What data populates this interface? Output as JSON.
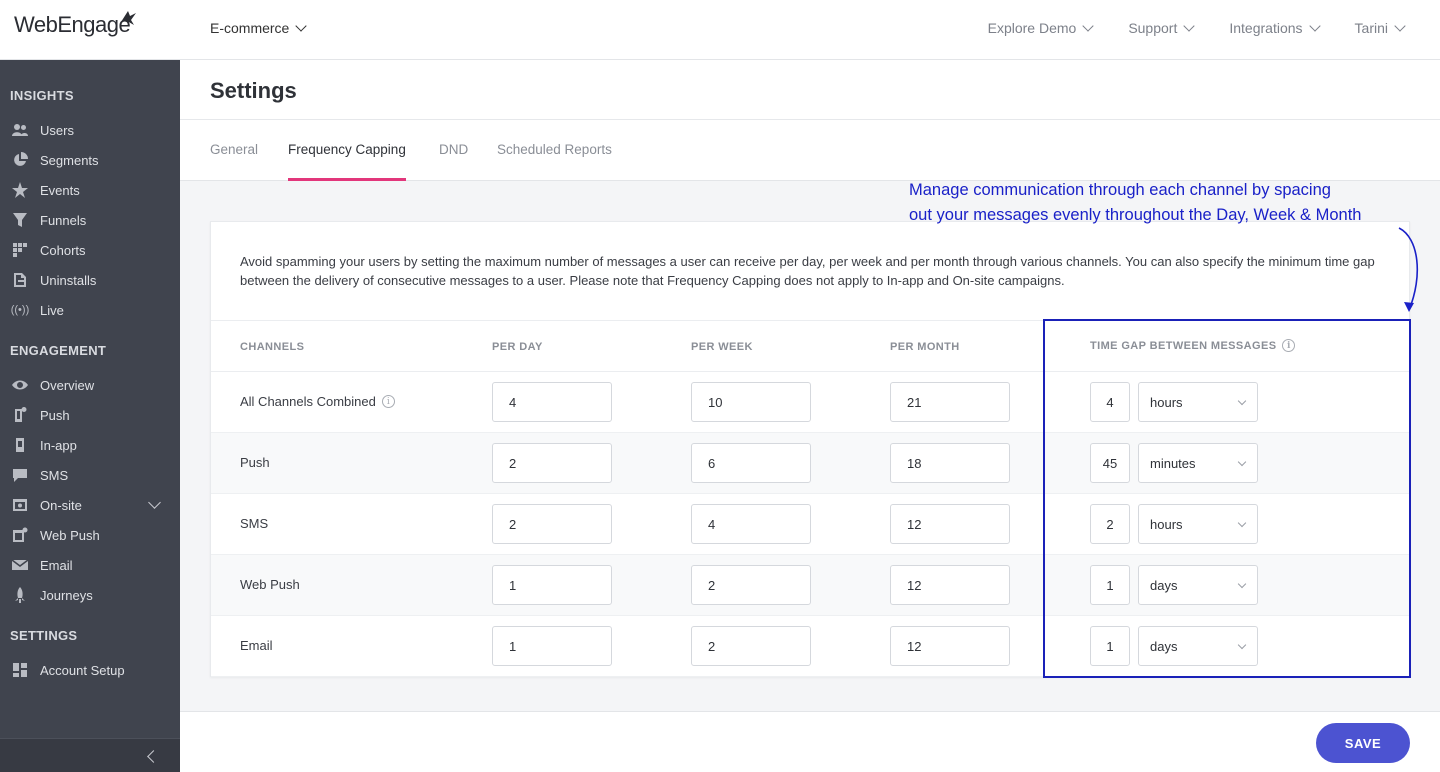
{
  "brand": {
    "logo_text": "WebEngage",
    "accent": "#e2367b",
    "primary": "#4c53d1",
    "annotation_color": "#1a21c8"
  },
  "header": {
    "project": "E-commerce",
    "nav": [
      "Explore Demo",
      "Support",
      "Integrations",
      "Tarini"
    ]
  },
  "sidebar": {
    "sections": [
      {
        "title": "INSIGHTS",
        "items": [
          {
            "label": "Users",
            "icon": "users-icon"
          },
          {
            "label": "Segments",
            "icon": "pie-chart-icon"
          },
          {
            "label": "Events",
            "icon": "star-icon"
          },
          {
            "label": "Funnels",
            "icon": "funnel-icon"
          },
          {
            "label": "Cohorts",
            "icon": "grid-icon"
          },
          {
            "label": "Uninstalls",
            "icon": "uninstall-icon"
          },
          {
            "label": "Live",
            "icon": "live-signal-icon"
          }
        ]
      },
      {
        "title": "ENGAGEMENT",
        "items": [
          {
            "label": "Overview",
            "icon": "eye-icon"
          },
          {
            "label": "Push",
            "icon": "mobile-push-icon"
          },
          {
            "label": "In-app",
            "icon": "mobile-inapp-icon"
          },
          {
            "label": "SMS",
            "icon": "chat-icon"
          },
          {
            "label": "On-site",
            "icon": "browser-icon"
          },
          {
            "label": "Web Push",
            "icon": "web-push-icon"
          },
          {
            "label": "Email",
            "icon": "envelope-icon"
          },
          {
            "label": "Journeys",
            "icon": "rocket-icon"
          }
        ]
      },
      {
        "title": "SETTINGS",
        "items": [
          {
            "label": "Account Setup",
            "icon": "dashboard-icon"
          }
        ]
      }
    ]
  },
  "page": {
    "title": "Settings",
    "tabs": [
      "General",
      "Frequency Capping",
      "DND",
      "Scheduled Reports"
    ],
    "active_tab": "Frequency Capping"
  },
  "card": {
    "description": "Avoid spamming your users by setting the maximum number of messages a user can receive per day, per week and per month through various channels. You can also specify the minimum time gap between the delivery of consecutive messages to a user. Please note that Frequency Capping does not apply to In-app and On-site campaigns.",
    "columns": [
      "CHANNELS",
      "PER DAY",
      "PER WEEK",
      "PER MONTH",
      "TIME GAP BETWEEN MESSAGES"
    ],
    "rows": [
      {
        "channel": "All Channels Combined",
        "per_day": "4",
        "per_week": "10",
        "per_month": "21",
        "gap_value": "4",
        "gap_unit": "hours"
      },
      {
        "channel": "Push",
        "per_day": "2",
        "per_week": "6",
        "per_month": "18",
        "gap_value": "45",
        "gap_unit": "minutes"
      },
      {
        "channel": "SMS",
        "per_day": "2",
        "per_week": "4",
        "per_month": "12",
        "gap_value": "2",
        "gap_unit": "hours"
      },
      {
        "channel": "Web Push",
        "per_day": "1",
        "per_week": "2",
        "per_month": "12",
        "gap_value": "1",
        "gap_unit": "days"
      },
      {
        "channel": "Email",
        "per_day": "1",
        "per_week": "2",
        "per_month": "12",
        "gap_value": "1",
        "gap_unit": "days"
      }
    ]
  },
  "annotation": {
    "line1": "Manage communication through each channel by spacing",
    "line2": "out your messages evenly throughout the Day, Week & Month"
  },
  "footer": {
    "save_label": "SAVE"
  }
}
